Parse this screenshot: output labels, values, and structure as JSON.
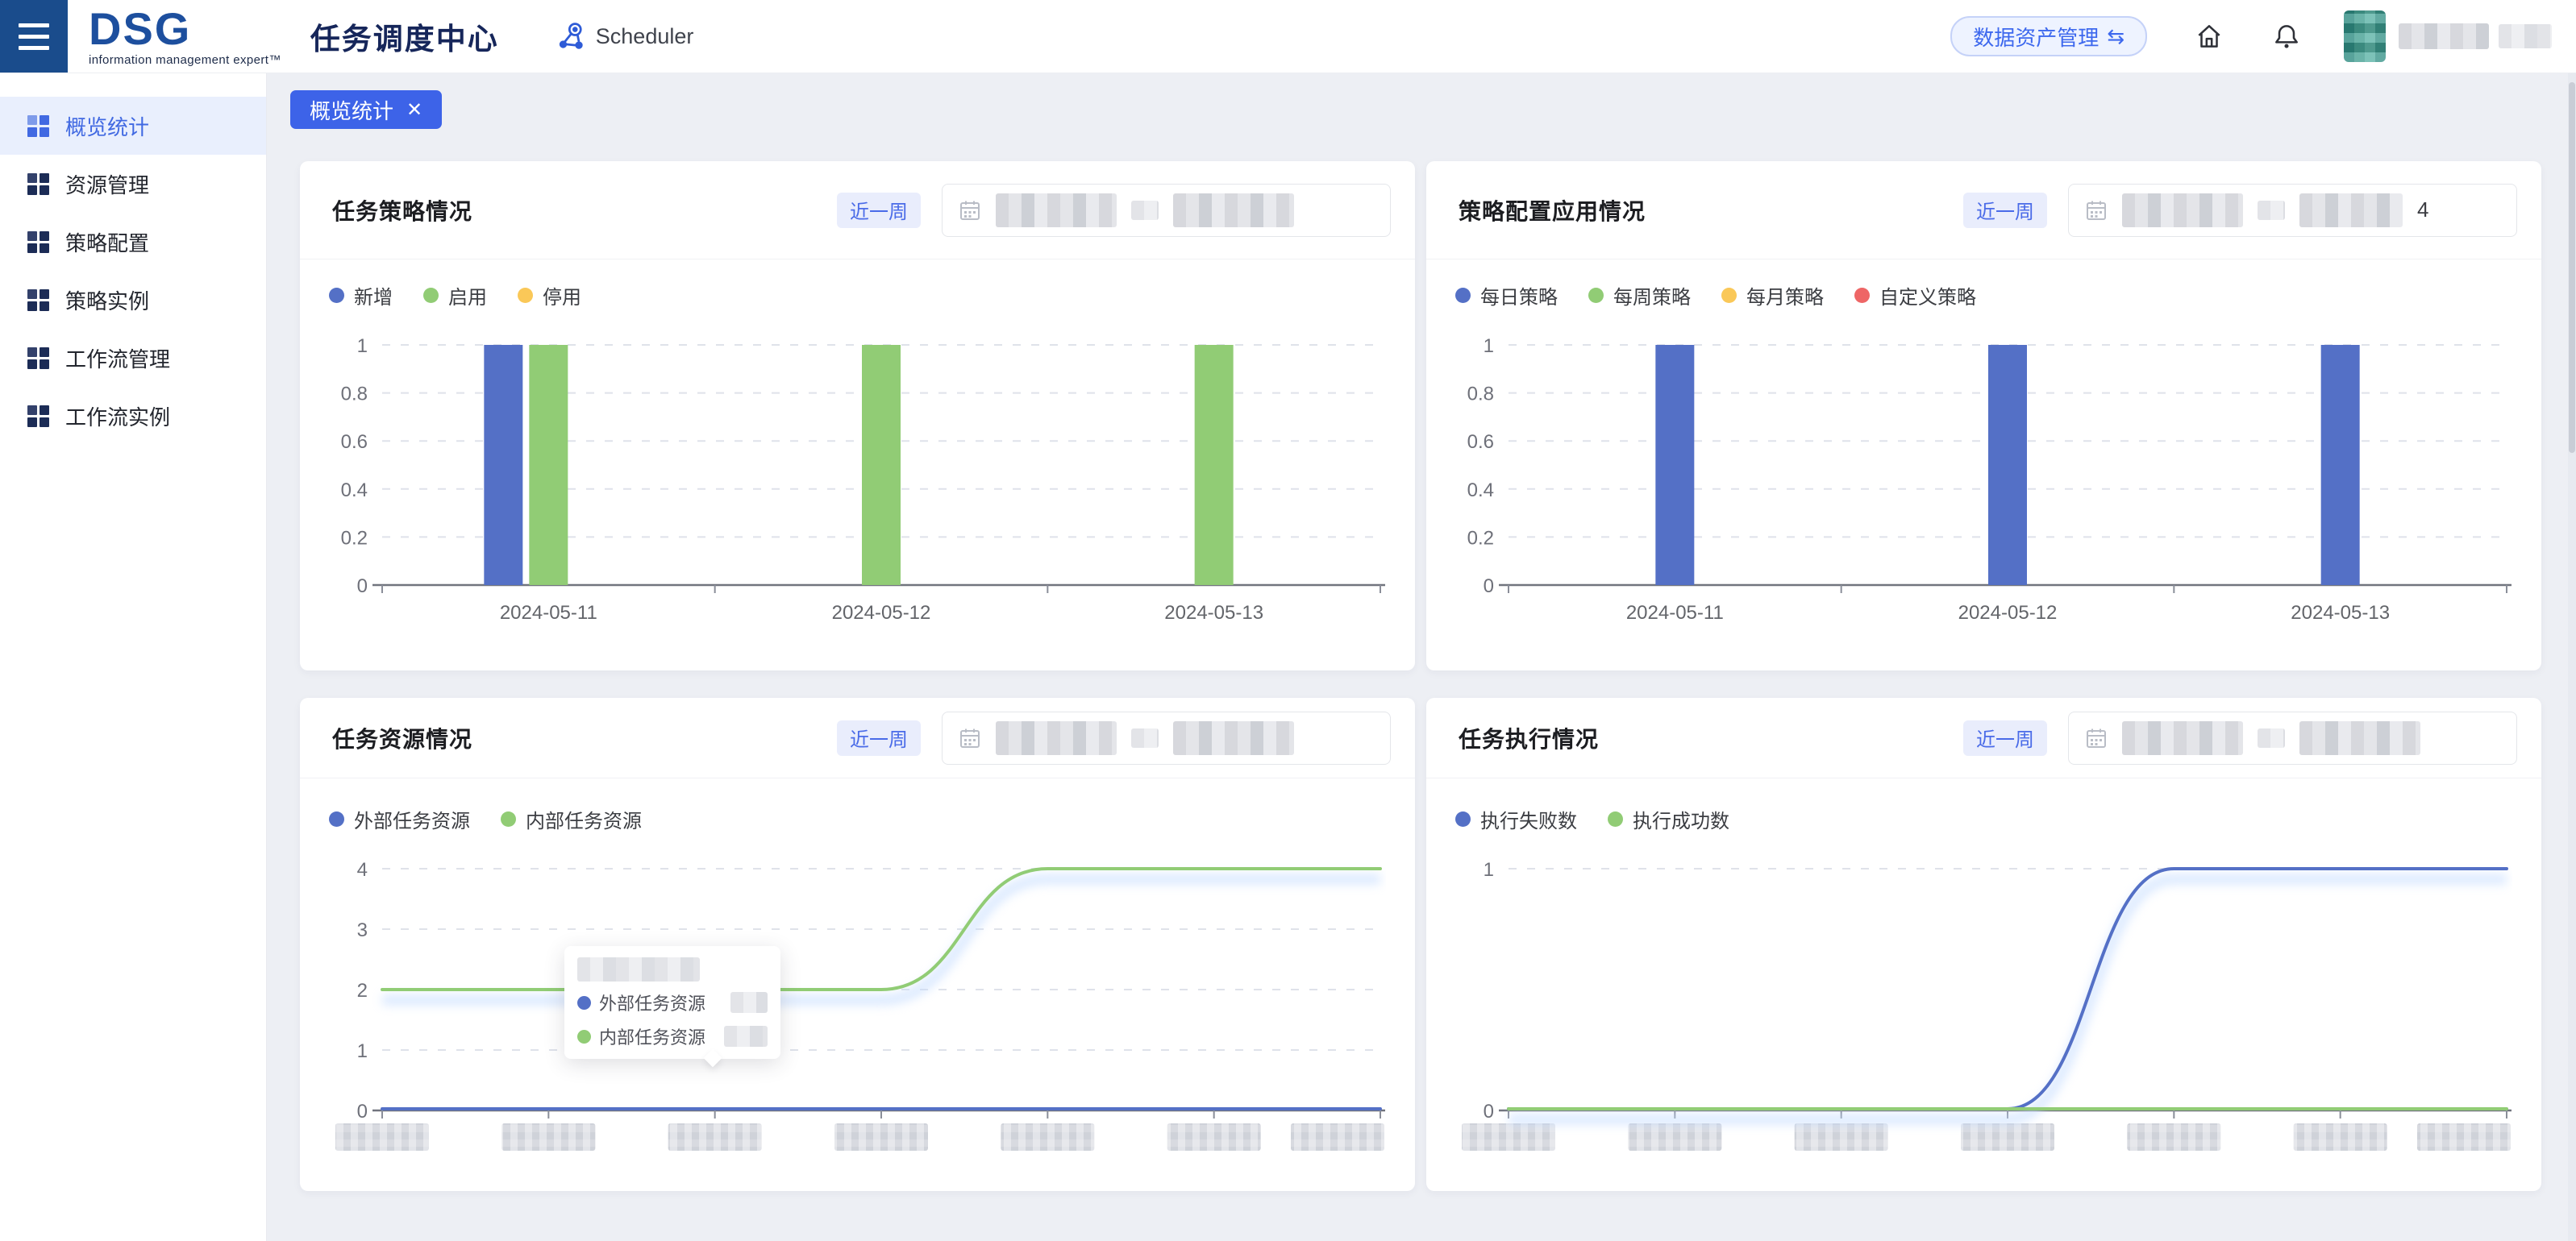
{
  "header": {
    "logo": "DSG",
    "logo_tagline": "information management expert™",
    "app_title": "任务调度中心",
    "product_label": "Scheduler",
    "asset_button_label": "数据资产管理",
    "asset_button_glyph": "⇆",
    "icons": [
      "menu-icon",
      "scheduler-icon",
      "home-icon",
      "bell-icon"
    ],
    "username_redacted": true
  },
  "sidebar": {
    "items": [
      {
        "label": "概览统计",
        "active": true
      },
      {
        "label": "资源管理",
        "active": false
      },
      {
        "label": "策略配置",
        "active": false
      },
      {
        "label": "策略实例",
        "active": false
      },
      {
        "label": "工作流管理",
        "active": false
      },
      {
        "label": "工作流实例",
        "active": false
      }
    ]
  },
  "tabs": {
    "open_tab": "概览统计",
    "close_glyph": "✕"
  },
  "colors": {
    "accent_blue": "#3D63E8",
    "series_blue": "#5470C6",
    "series_green": "#91CC75",
    "series_yellow": "#FAC858",
    "series_red": "#EE6666",
    "sidebar_active": "#4169E2",
    "burger_bg": "#1A4C8C"
  },
  "cards": [
    {
      "title": "任务策略情况",
      "range_label": "近一周",
      "date_start_redacted": true,
      "date_end_redacted": true,
      "date_end_suffix": ""
    },
    {
      "title": "策略配置应用情况",
      "range_label": "近一周",
      "date_start_redacted": true,
      "date_end_redacted": true,
      "date_end_suffix": "4"
    },
    {
      "title": "任务资源情况",
      "range_label": "近一周",
      "date_start_redacted": true,
      "date_end_redacted": true,
      "date_end_suffix": ""
    },
    {
      "title": "任务执行情况",
      "range_label": "近一周",
      "date_start_redacted": true,
      "date_end_redacted": true,
      "date_end_suffix": ""
    }
  ],
  "chart_data": [
    {
      "type": "bar",
      "title": "任务策略情况",
      "categories": [
        "2024-05-11",
        "2024-05-12",
        "2024-05-13"
      ],
      "legend": [
        {
          "name": "新增",
          "color": "#5470C6"
        },
        {
          "name": "启用",
          "color": "#91CC75"
        },
        {
          "name": "停用",
          "color": "#FAC858"
        }
      ],
      "bar_slots": 3,
      "series": [
        {
          "name": "新增",
          "color": "#5470C6",
          "slot": 0,
          "values": [
            1,
            null,
            null
          ]
        },
        {
          "name": "启用",
          "color": "#91CC75",
          "slot": 1,
          "values": [
            1,
            1,
            1
          ]
        },
        {
          "name": "停用",
          "color": "#FAC858",
          "slot": 2,
          "values": [
            null,
            null,
            null
          ]
        }
      ],
      "ylim": [
        0,
        1
      ],
      "yticks": [
        0,
        0.2,
        0.4,
        0.6,
        0.8,
        1
      ],
      "grid": "dashed",
      "legend_position": "top-left"
    },
    {
      "type": "bar",
      "title": "策略配置应用情况",
      "categories": [
        "2024-05-11",
        "2024-05-12",
        "2024-05-13"
      ],
      "legend": [
        {
          "name": "每日策略",
          "color": "#5470C6"
        },
        {
          "name": "每周策略",
          "color": "#91CC75"
        },
        {
          "name": "每月策略",
          "color": "#FAC858"
        },
        {
          "name": "自定义策略",
          "color": "#EE6666"
        }
      ],
      "bar_slots": 1,
      "series": [
        {
          "name": "每日策略",
          "color": "#5470C6",
          "slot": 0,
          "values": [
            1,
            1,
            1
          ]
        },
        {
          "name": "每周策略",
          "color": "#91CC75",
          "slot": 0,
          "values": [
            null,
            null,
            null
          ]
        },
        {
          "name": "每月策略",
          "color": "#FAC858",
          "slot": 0,
          "values": [
            null,
            null,
            null
          ]
        },
        {
          "name": "自定义策略",
          "color": "#EE6666",
          "slot": 0,
          "values": [
            null,
            null,
            null
          ]
        }
      ],
      "ylim": [
        0,
        1
      ],
      "yticks": [
        0,
        0.2,
        0.4,
        0.6,
        0.8,
        1
      ],
      "grid": "dashed",
      "legend_position": "top-left"
    },
    {
      "type": "line",
      "title": "任务资源情况",
      "x_labels_redacted": true,
      "n_points": 7,
      "legend": [
        {
          "name": "外部任务资源",
          "color": "#5470C6"
        },
        {
          "name": "内部任务资源",
          "color": "#91CC75"
        }
      ],
      "series": [
        {
          "name": "外部任务资源",
          "color": "#5470C6",
          "values": [
            0,
            0,
            0,
            0,
            0,
            0,
            0
          ]
        },
        {
          "name": "内部任务资源",
          "color": "#91CC75",
          "values": [
            2,
            2,
            2,
            2,
            4,
            4,
            4
          ]
        }
      ],
      "ylim": [
        0,
        4
      ],
      "yticks": [
        0,
        1,
        2,
        3,
        4
      ],
      "grid": "dashed",
      "legend_position": "top-left",
      "tooltip": {
        "visible": true,
        "title_redacted": true,
        "rows": [
          {
            "name": "外部任务资源",
            "color": "#5470C6",
            "value_redacted": true
          },
          {
            "name": "内部任务资源",
            "color": "#91CC75",
            "value_redacted": true
          }
        ]
      }
    },
    {
      "type": "line",
      "title": "任务执行情况",
      "x_labels_redacted": true,
      "n_points": 7,
      "legend": [
        {
          "name": "执行失败数",
          "color": "#5470C6"
        },
        {
          "name": "执行成功数",
          "color": "#91CC75"
        }
      ],
      "series": [
        {
          "name": "执行失败数",
          "color": "#5470C6",
          "values": [
            0,
            0,
            0,
            0,
            1,
            1,
            1
          ]
        },
        {
          "name": "执行成功数",
          "color": "#91CC75",
          "values": [
            0,
            0,
            0,
            0,
            0,
            0,
            0
          ]
        }
      ],
      "ylim": [
        0,
        1
      ],
      "yticks": [
        0,
        1
      ],
      "grid": "dashed",
      "legend_position": "top-left"
    }
  ]
}
